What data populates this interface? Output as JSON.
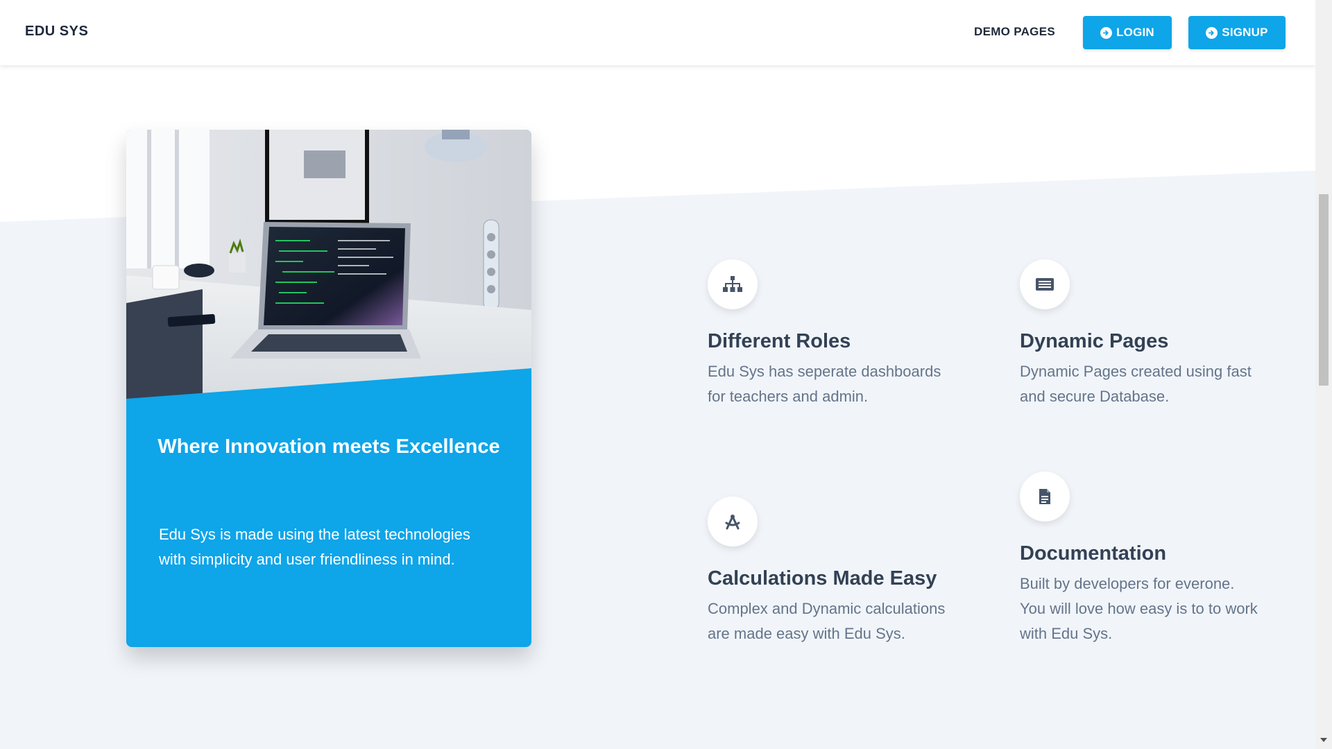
{
  "navbar": {
    "brand": "EDU SYS",
    "demo_pages": "DEMO PAGES",
    "login": "LOGIN",
    "signup": "SIGNUP"
  },
  "colors": {
    "accent": "#0ea5e9",
    "section_bg": "#f1f5f9",
    "heading": "#334155",
    "body_text": "#64748b"
  },
  "card": {
    "image_alt": "laptop-on-desk-photo",
    "title": "Where Innovation meets Excellence",
    "text": "Edu Sys is made using the latest technologies with simplicity and user friendliness in mind."
  },
  "features": [
    {
      "icon": "sitemap-icon",
      "title": "Different Roles",
      "text": "Edu Sys has seperate dashboards for teachers and admin."
    },
    {
      "icon": "newspaper-icon",
      "title": "Dynamic Pages",
      "text": "Dynamic Pages created using fast and secure Database."
    },
    {
      "icon": "drafting-compass-icon",
      "title": "Calculations Made Easy",
      "text": "Complex and Dynamic calculations are made easy with Edu Sys."
    },
    {
      "icon": "file-icon",
      "title": "Documentation",
      "text": "Built by developers for everone. You will love how easy is to to work with Edu Sys."
    }
  ]
}
